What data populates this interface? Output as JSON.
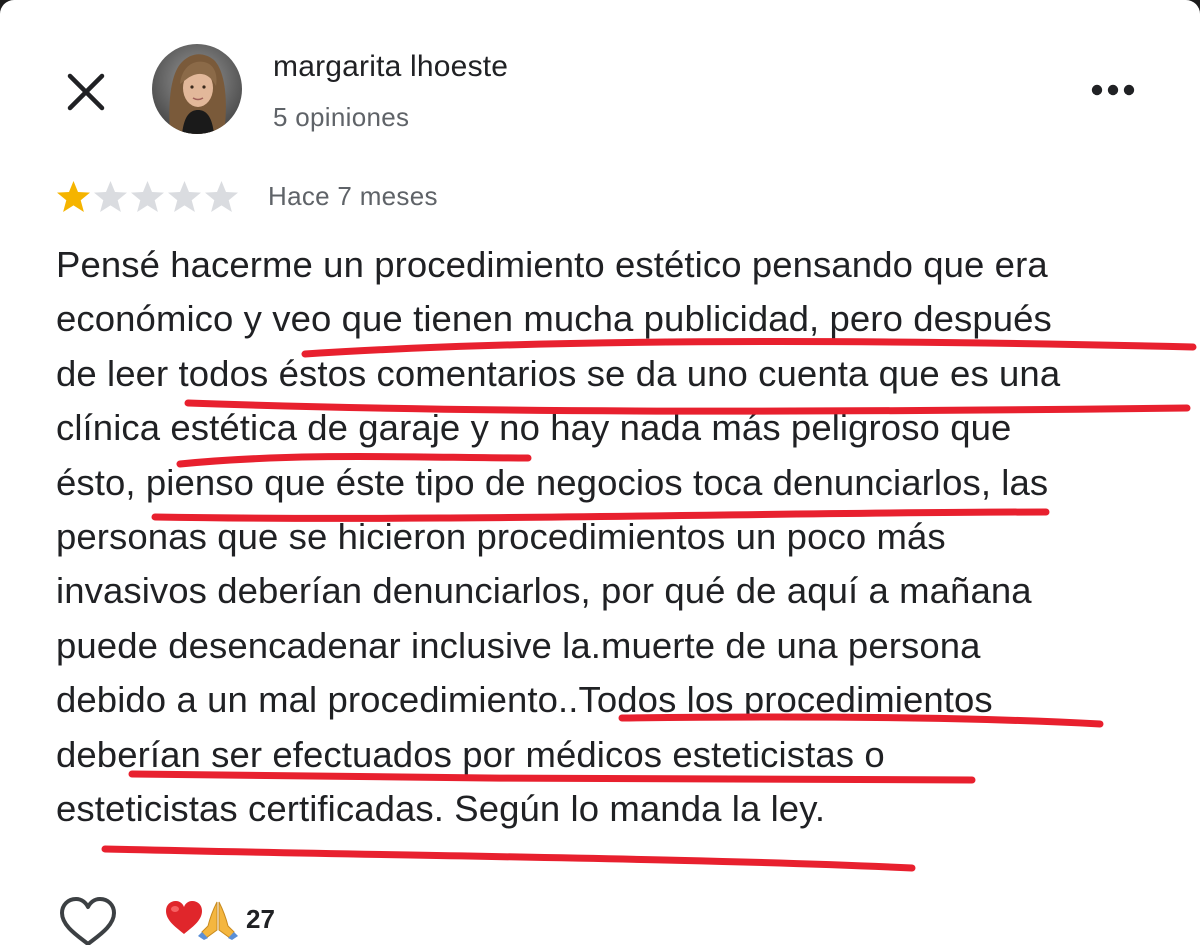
{
  "reviewer": {
    "name": "margarita lhoeste",
    "review_count": "5 opiniones"
  },
  "review": {
    "rating": 1,
    "max_rating": 5,
    "time": "Hace 7 meses",
    "lines": [
      "Pensé hacerme un procedimiento estético pensando que era",
      "económico y veo que tienen mucha publicidad, pero después",
      "de leer todos éstos comentarios se da uno cuenta que es una",
      "clínica estética de garaje y no hay nada más peligroso que",
      "ésto, pienso que éste tipo de negocios toca denunciarlos, las",
      "personas que se hicieron procedimientos un poco más",
      "invasivos deberían denunciarlos, por qué de aquí a mañana",
      "puede desencadenar inclusive la.muerte de una persona",
      "debido a un mal procedimiento..Todos los procedimientos",
      "deberían ser efectuados por médicos esteticistas o",
      "esteticistas certificadas. Según lo manda la ley."
    ]
  },
  "reactions": {
    "count": "27",
    "icons": [
      "heart-emoji-icon",
      "praying-hands-emoji-icon"
    ]
  },
  "icons": {
    "close": "close-icon",
    "more": "more-options-icon",
    "like": "heart-outline-icon"
  },
  "colors": {
    "star_filled": "#f5b400",
    "star_empty": "#dadce0",
    "underline": "#e8202e",
    "text": "#202124",
    "muted": "#5f6368"
  }
}
